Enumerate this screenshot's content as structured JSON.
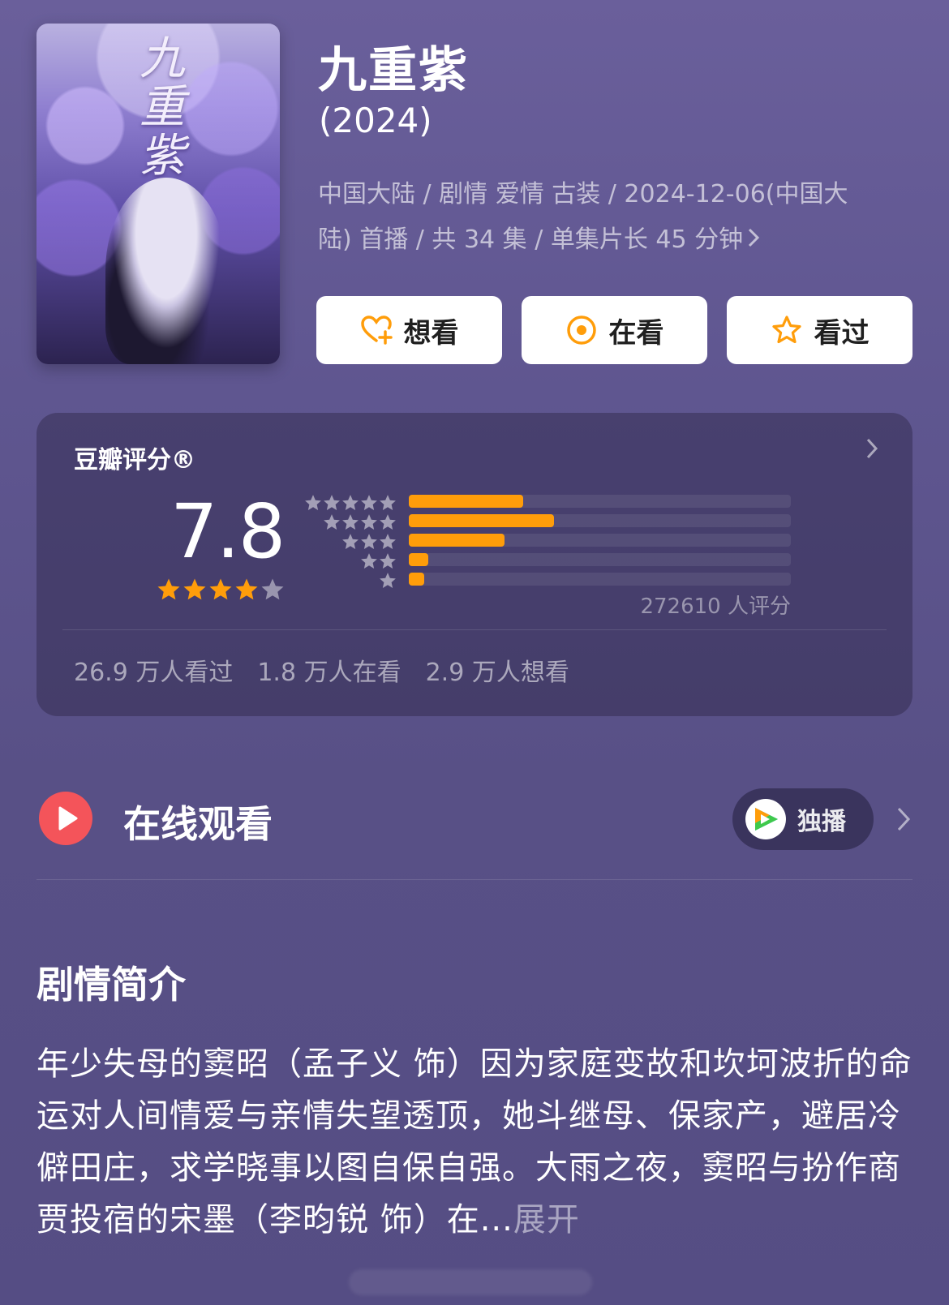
{
  "show": {
    "title": "九重紫",
    "year": "(2024)",
    "poster_title": "九重紫",
    "meta_line1": "中国大陆 / 剧情 爱情 古装 / 2024-12-06(中国大",
    "meta_line2": "陆) 首播 / 共 34 集 / 单集片长 45 分钟"
  },
  "actions": {
    "want_label": "想看",
    "watching_label": "在看",
    "watched_label": "看过"
  },
  "rating": {
    "label": "豆瓣评分®",
    "score": "7.8",
    "stars": 4,
    "distribution": [
      {
        "stars": 5,
        "fraction": 0.3
      },
      {
        "stars": 4,
        "fraction": 0.38
      },
      {
        "stars": 3,
        "fraction": 0.25
      },
      {
        "stars": 2,
        "fraction": 0.05
      },
      {
        "stars": 1,
        "fraction": 0.04
      }
    ],
    "rater_count": "272610 人评分",
    "watched": "26.9 万人看过",
    "watching": "1.8 万人在看",
    "want": "2.9 万人想看"
  },
  "online": {
    "title": "在线观看",
    "exclusive_label": "独播",
    "play_icon": "play-icon",
    "platform_icon": "tencent-video-icon"
  },
  "synopsis": {
    "title": "剧情简介",
    "text": "年少失母的窦昭（孟子义 饰）因为家庭变故和坎坷波折的命运对人间情爱与亲情失望透顶，她斗继母、保家产，避居冷僻田庄，求学晓事以图自保自强。大雨之夜，窦昭与扮作商贾投宿的宋墨（李昀锐 饰）在...",
    "expand_label": "展开"
  },
  "colors": {
    "accent": "#ff9d0a",
    "play_red": "#f4545a",
    "background": "#5f5690"
  }
}
